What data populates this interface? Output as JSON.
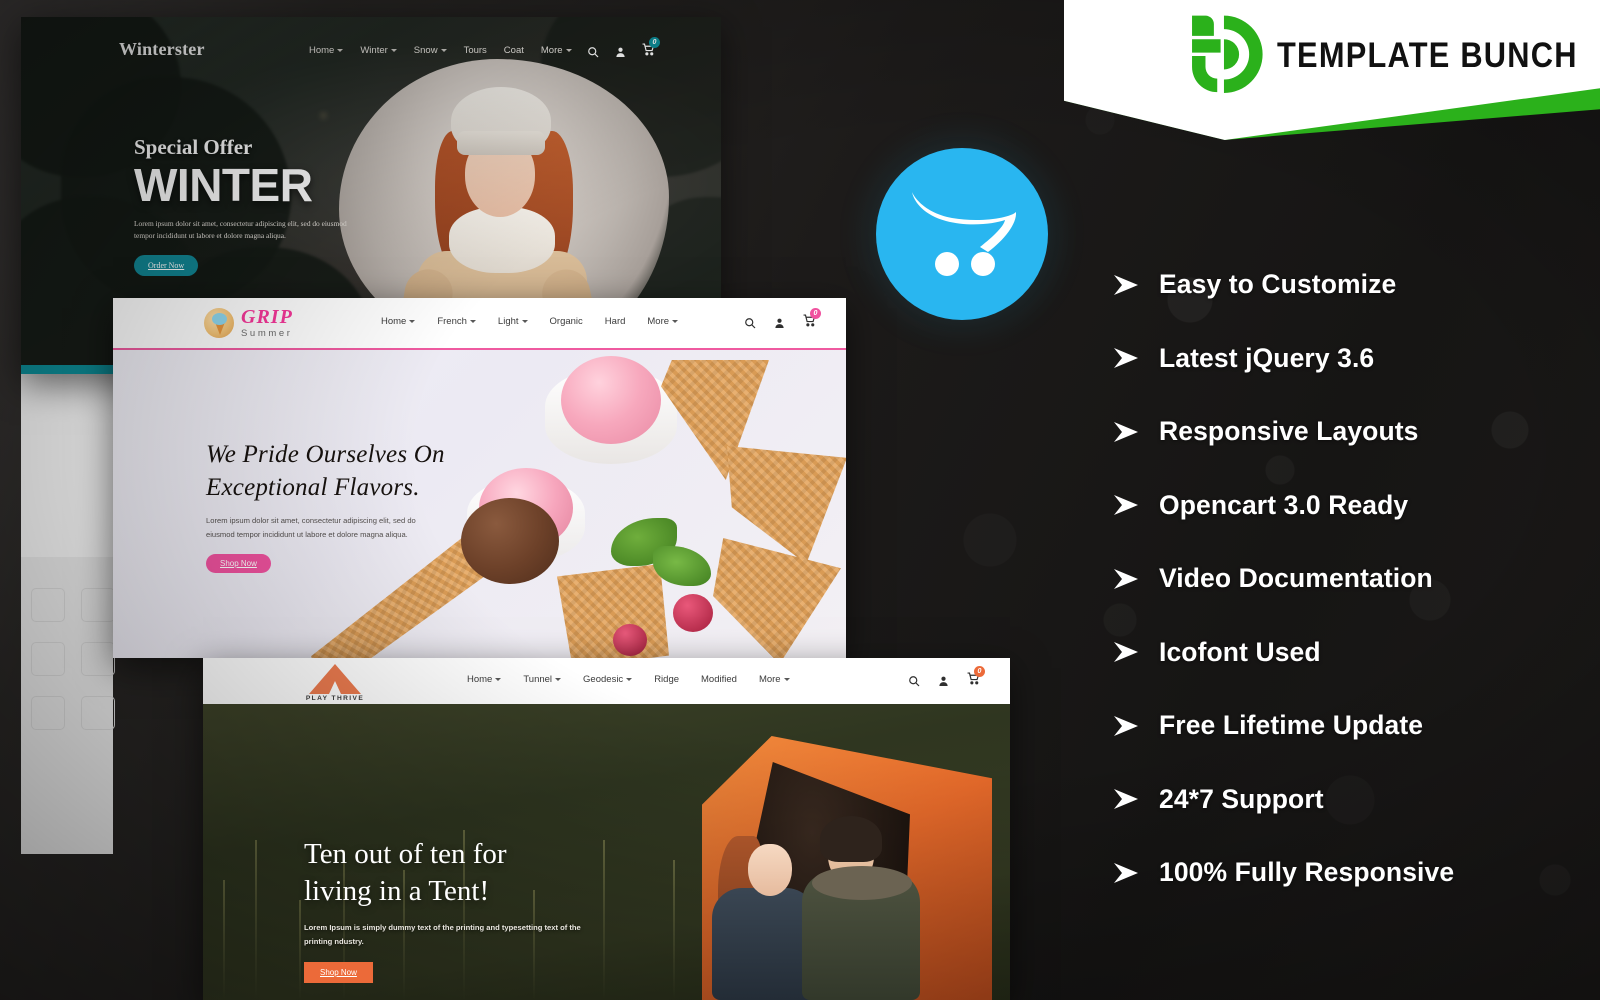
{
  "brand": {
    "name": "TEMPLATE BUNCH",
    "logo_icon": "template-bunch-b-logo",
    "accent_green": "#2bb11b",
    "band_white": "#ffffff"
  },
  "platform": {
    "logo_icon": "opencart-cart-logo",
    "color": "#29b6f0"
  },
  "features": [
    {
      "label": "Easy to Customize",
      "bullet_icon": "arrow-right-icon"
    },
    {
      "label": "Latest jQuery 3.6",
      "bullet_icon": "arrow-right-icon"
    },
    {
      "label": "Responsive Layouts",
      "bullet_icon": "arrow-right-icon"
    },
    {
      "label": "Opencart 3.0 Ready",
      "bullet_icon": "arrow-right-icon"
    },
    {
      "label": "Video Documentation",
      "bullet_icon": "arrow-right-icon"
    },
    {
      "label": "Icofont Used",
      "bullet_icon": "arrow-right-icon"
    },
    {
      "label": "Free Lifetime Update",
      "bullet_icon": "arrow-right-icon"
    },
    {
      "label": "24*7 Support",
      "bullet_icon": "arrow-right-icon"
    },
    {
      "label": "100% Fully Responsive",
      "bullet_icon": "arrow-right-icon"
    }
  ],
  "mockups": {
    "winterster": {
      "logo": "Winterster",
      "menu": [
        {
          "label": "Home",
          "has_dropdown": true
        },
        {
          "label": "Winter",
          "has_dropdown": true
        },
        {
          "label": "Snow",
          "has_dropdown": true
        },
        {
          "label": "Tours",
          "has_dropdown": false
        },
        {
          "label": "Coat",
          "has_dropdown": false
        },
        {
          "label": "More",
          "has_dropdown": true
        }
      ],
      "icons": [
        "search-icon",
        "account-icon",
        "cart-icon"
      ],
      "cart_count": "0",
      "hero": {
        "eyebrow": "Special Offer",
        "title": "WINTER",
        "paragraph": "Lorem ipsum dolor sit amet, consectetur adipiscing elit, sed do eiusmod tempor incididunt ut labore et dolore magna aliqua.",
        "cta": "Order Now"
      },
      "accent": "#0d8f9a"
    },
    "grip": {
      "logo_main": "GRIP",
      "logo_sub": "Summer",
      "menu": [
        {
          "label": "Home",
          "has_dropdown": true
        },
        {
          "label": "French",
          "has_dropdown": true
        },
        {
          "label": "Light",
          "has_dropdown": true
        },
        {
          "label": "Organic",
          "has_dropdown": false
        },
        {
          "label": "Hard",
          "has_dropdown": false
        },
        {
          "label": "More",
          "has_dropdown": true
        }
      ],
      "icons": [
        "search-icon",
        "account-icon",
        "cart-icon"
      ],
      "cart_count": "0",
      "hero": {
        "title_line1": "We Pride Ourselves On",
        "title_line2": "Exceptional Flavors.",
        "paragraph": "Lorem ipsum dolor sit amet, consectetur adipiscing elit, sed do eiusmod tempor incididunt ut labore et dolore magna aliqua.",
        "cta": "Shop Now"
      },
      "accent": "#f0529f"
    },
    "playthrive": {
      "logo": "PLAY THRIVE",
      "menu": [
        {
          "label": "Home",
          "has_dropdown": true
        },
        {
          "label": "Tunnel",
          "has_dropdown": true
        },
        {
          "label": "Geodesic",
          "has_dropdown": true
        },
        {
          "label": "Ridge",
          "has_dropdown": false
        },
        {
          "label": "Modified",
          "has_dropdown": false
        },
        {
          "label": "More",
          "has_dropdown": true
        }
      ],
      "icons": [
        "search-icon",
        "account-icon",
        "cart-icon"
      ],
      "cart_count": "0",
      "hero": {
        "title_line1": "Ten out of ten for",
        "title_line2": "living in a Tent!",
        "paragraph": "Lorem Ipsum is simply dummy text of the printing and typesetting text of the printing ndustry.",
        "cta": "Shop Now"
      },
      "accent": "#ec6a39"
    }
  }
}
